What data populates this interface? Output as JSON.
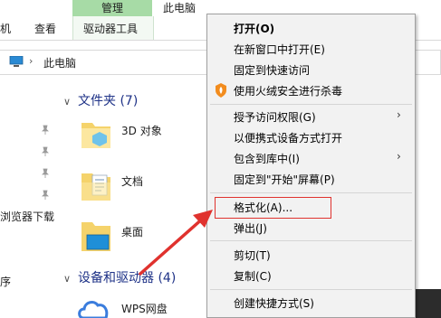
{
  "ribbon": {
    "tabs_top": {
      "manage": "管理",
      "this_pc": "此电脑"
    },
    "tabs": [
      "机",
      "查看",
      "驱动器工具"
    ]
  },
  "address": {
    "path": "此电脑"
  },
  "nav": {
    "items": [
      "浏览器下载",
      "序"
    ]
  },
  "content": {
    "group_folders": "文件夹 (7)",
    "group_drives": "设备和驱动器 (4)",
    "folders": [
      "3D 对象",
      "文档",
      "桌面"
    ],
    "drives": [
      "WPS网盘"
    ]
  },
  "context_menu": {
    "items": [
      {
        "label": "打开(O)",
        "bold": true
      },
      {
        "label": "在新窗口中打开(E)"
      },
      {
        "label": "固定到快速访问"
      },
      {
        "label": "使用火绒安全进行杀毒",
        "icon": "huorong-shield-icon"
      },
      {
        "label": "授予访问权限(G)",
        "submenu": true
      },
      {
        "label": "以便携式设备方式打开"
      },
      {
        "label": "包含到库中(I)",
        "submenu": true
      },
      {
        "label": "固定到\"开始\"屏幕(P)"
      },
      {
        "label": "格式化(A)...",
        "highlighted": true
      },
      {
        "label": "弹出(J)"
      },
      {
        "label": "剪切(T)"
      },
      {
        "label": "复制(C)"
      },
      {
        "label": "创建快捷方式(S)"
      }
    ],
    "submenu_arrow": "›"
  },
  "colors": {
    "manage_tab": "#a7dba6",
    "group_heading": "#1e3287",
    "annotation": "#e0322e",
    "menu_bg": "#f2f2f2"
  }
}
